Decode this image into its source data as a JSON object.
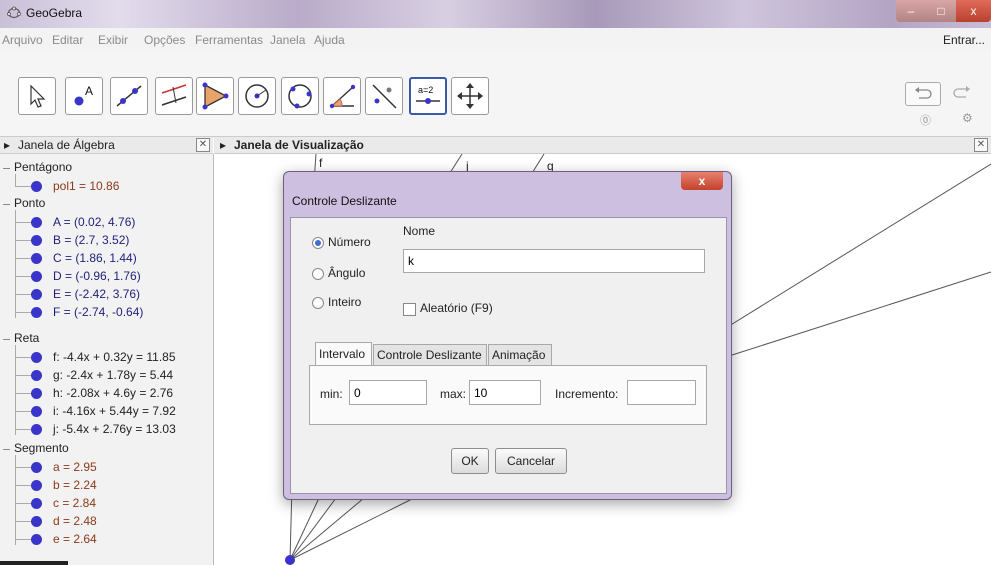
{
  "window": {
    "title": "GeoGebra"
  },
  "menu": {
    "items": [
      "Arquivo",
      "Editar",
      "Exibir",
      "Opções",
      "Ferramentas",
      "Janela",
      "Ajuda"
    ],
    "signin": "Entrar..."
  },
  "toolbar": {
    "tools": [
      "move-tool",
      "point-tool",
      "line-tool",
      "perpendicular-line-tool",
      "polygon-tool",
      "circle-tool",
      "conic-tool",
      "angle-tool",
      "reflect-tool",
      "slider-tool",
      "move-graphics-view-tool"
    ],
    "active_tool": "slider-tool",
    "slider_tool_text": "a=2"
  },
  "algebra_view": {
    "header": "Janela de Álgebra",
    "groups": [
      {
        "name": "Pentágono",
        "items": [
          {
            "text": "pol1 = 10.86",
            "color": "#8b3a1a"
          }
        ]
      },
      {
        "name": "Ponto",
        "items": [
          {
            "text": "A = (0.02, 4.76)",
            "color": "#1f1f7a"
          },
          {
            "text": "B = (2.7, 3.52)",
            "color": "#1f1f7a"
          },
          {
            "text": "C = (1.86, 1.44)",
            "color": "#1f1f7a"
          },
          {
            "text": "D = (-0.96, 1.76)",
            "color": "#1f1f7a"
          },
          {
            "text": "E = (-2.42, 3.76)",
            "color": "#1f1f7a"
          },
          {
            "text": "F = (-2.74, -0.64)",
            "color": "#1f1f7a"
          }
        ]
      },
      {
        "name": "Reta",
        "items": [
          {
            "text": "f: -4.4x + 0.32y = 11.85",
            "color": "#222222"
          },
          {
            "text": "g: -2.4x + 1.78y = 5.44",
            "color": "#222222"
          },
          {
            "text": "h: -2.08x + 4.6y = 2.76",
            "color": "#222222"
          },
          {
            "text": "i: -4.16x + 5.44y = 7.92",
            "color": "#222222"
          },
          {
            "text": "j: -5.4x + 2.76y = 13.03",
            "color": "#222222"
          }
        ]
      },
      {
        "name": "Segmento",
        "items": [
          {
            "text": "a = 2.95",
            "color": "#8b3a1a"
          },
          {
            "text": "b = 2.24",
            "color": "#8b3a1a"
          },
          {
            "text": "c = 2.84",
            "color": "#8b3a1a"
          },
          {
            "text": "d = 2.48",
            "color": "#8b3a1a"
          },
          {
            "text": "e = 2.64",
            "color": "#8b3a1a"
          }
        ]
      }
    ]
  },
  "graphics_view": {
    "header": "Janela de Visualização",
    "line_labels": [
      "f",
      "j",
      "g"
    ]
  },
  "dialog": {
    "title": "Controle Deslizante",
    "close": "x",
    "type_options": [
      "Número",
      "Ângulo",
      "Inteiro"
    ],
    "selected_type": "Número",
    "name_caption": "Nome",
    "name_value": "k",
    "random_label": "Aleatório (F9)",
    "tabs": [
      "Intervalo",
      "Controle Deslizante",
      "Animação"
    ],
    "selected_tab": "Intervalo",
    "min_label": "min:",
    "min_value": "0",
    "max_label": "max:",
    "max_value": "10",
    "increment_label": "Incremento:",
    "increment_value": "",
    "ok_label": "OK",
    "cancel_label": "Cancelar"
  },
  "colors": {
    "dot": "#3a35c9",
    "active_tool_border": "#3b5ba8",
    "dialog_frame": "#cdbfe0"
  }
}
